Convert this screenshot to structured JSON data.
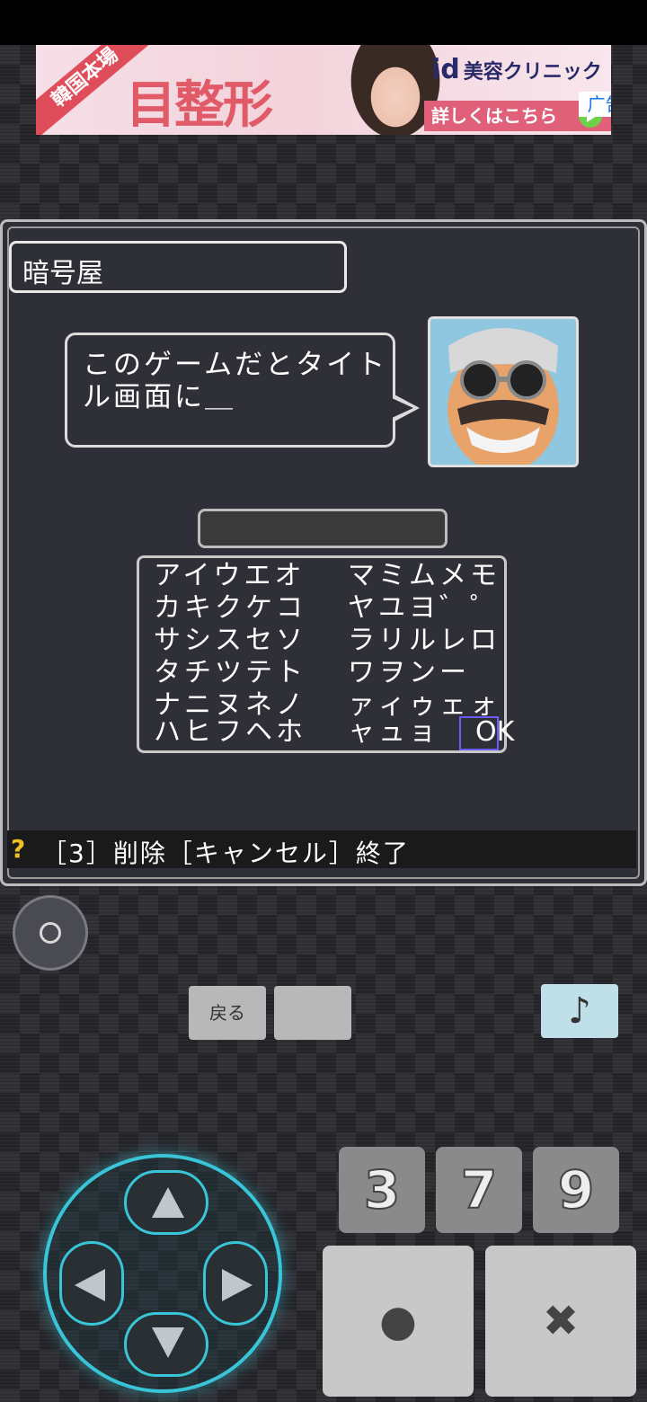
{
  "ad": {
    "ribbon": "韓国本場",
    "headline": "目整形",
    "brand": "id",
    "brand_sub": "美容クリニック",
    "cta": "詳しくはこちら",
    "label": "广告✕"
  },
  "dialog": {
    "speaker": "暗号屋",
    "message": "このゲームだとタイトル画面に＿"
  },
  "kana_grid": {
    "rows": [
      {
        "left": "アイウエオ",
        "right": "マミムメモ"
      },
      {
        "left": "カキクケコ",
        "right": "ヤユヨ゛゜"
      },
      {
        "left": "サシスセソ",
        "right": "ラリルレロ"
      },
      {
        "left": "タチツテト",
        "right": "ワヲンー"
      },
      {
        "left": "ナニヌネノ",
        "right": "ァィゥェォ"
      },
      {
        "left": "ハヒフヘホ",
        "right": "ャュョ"
      }
    ],
    "ok_label": "OK"
  },
  "help": {
    "icon": "?",
    "text": "［3］削除［キャンセル］終了"
  },
  "controls": {
    "back_label": "戻る",
    "music_label": "♪",
    "num_keys": [
      "3",
      "7",
      "9"
    ],
    "confirm_label": "●",
    "cancel_label": "✖"
  }
}
